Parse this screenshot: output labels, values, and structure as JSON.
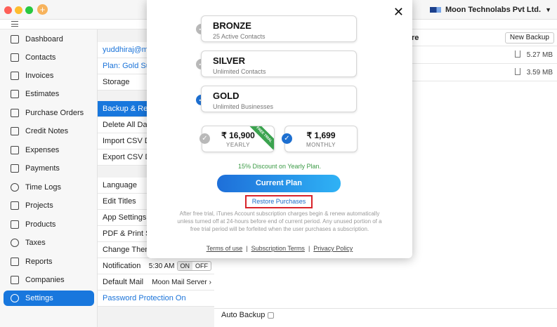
{
  "titlebar": {
    "company_name": "Moon Technolabs Pvt Ltd."
  },
  "sidebar": {
    "items": [
      {
        "label": "Dashboard",
        "icon": "home-icon"
      },
      {
        "label": "Contacts",
        "icon": "contacts-icon"
      },
      {
        "label": "Invoices",
        "icon": "invoice-icon"
      },
      {
        "label": "Estimates",
        "icon": "estimate-icon"
      },
      {
        "label": "Purchase Orders",
        "icon": "cart-icon"
      },
      {
        "label": "Credit Notes",
        "icon": "credit-note-icon"
      },
      {
        "label": "Expenses",
        "icon": "wallet-icon"
      },
      {
        "label": "Payments",
        "icon": "payment-icon"
      },
      {
        "label": "Time Logs",
        "icon": "clock-icon"
      },
      {
        "label": "Projects",
        "icon": "folder-icon"
      },
      {
        "label": "Products",
        "icon": "box-icon"
      },
      {
        "label": "Taxes",
        "icon": "percent-icon"
      },
      {
        "label": "Reports",
        "icon": "report-icon"
      },
      {
        "label": "Companies",
        "icon": "building-icon"
      },
      {
        "label": "Settings",
        "icon": "gear-icon"
      }
    ]
  },
  "settings": {
    "email": "yuddhiraj@mo",
    "plan": "Plan: Gold Sul",
    "storage": "Storage",
    "backup": "Backup & Res",
    "delete_all": "Delete All Dat",
    "import_csv": "Import CSV D",
    "export_csv": "Export CSV D",
    "language": "Language",
    "edit_titles": "Edit Titles",
    "app_settings": "App Settings",
    "pdf_print": "PDF & Print Se",
    "change_theme": "Change Them",
    "notification": "Notification",
    "notification_time": "5:30 AM",
    "toggle_on": "ON",
    "toggle_off": "OFF",
    "default_mail": "Default Mail",
    "default_mail_value": "Moon Mail Server",
    "password_protection": "Password Protection On"
  },
  "backups": {
    "title_fragment": "re",
    "new_backup": "New Backup",
    "rows": [
      {
        "size": "5.27 MB"
      },
      {
        "size": "3.59 MB"
      }
    ],
    "auto_backup": "Auto Backup"
  },
  "modal": {
    "plans": [
      {
        "name": "BRONZE",
        "desc": "25 Active Contacts",
        "selected": false
      },
      {
        "name": "SILVER",
        "desc": "Unlimited Contacts",
        "selected": false
      },
      {
        "name": "GOLD",
        "desc": "Unlimited Businesses",
        "selected": true
      }
    ],
    "prices": [
      {
        "amount": "₹ 16,900",
        "period": "YEARLY",
        "selected": false,
        "ribbon": "FREE TRIAL"
      },
      {
        "amount": "₹ 1,699",
        "period": "MONTHLY",
        "selected": true
      }
    ],
    "discount": "15% Discount on Yearly Plan.",
    "current_plan": "Current Plan",
    "restore": "Restore Purchases",
    "disclaimer": "After free trial, iTunes Account subscription charges begin & renew automatically unless turned off at 24-hours before end of current period. Any unused portion of a free trial period will be forfeited when the user purchases a subscription.",
    "terms": "Terms of use",
    "subscription_terms": "Subscription Terms",
    "privacy": "Privacy Policy",
    "separator": "|"
  },
  "colors": {
    "accent": "#1877dd",
    "green": "#3ba34f",
    "highlight_border": "#d8232a"
  }
}
